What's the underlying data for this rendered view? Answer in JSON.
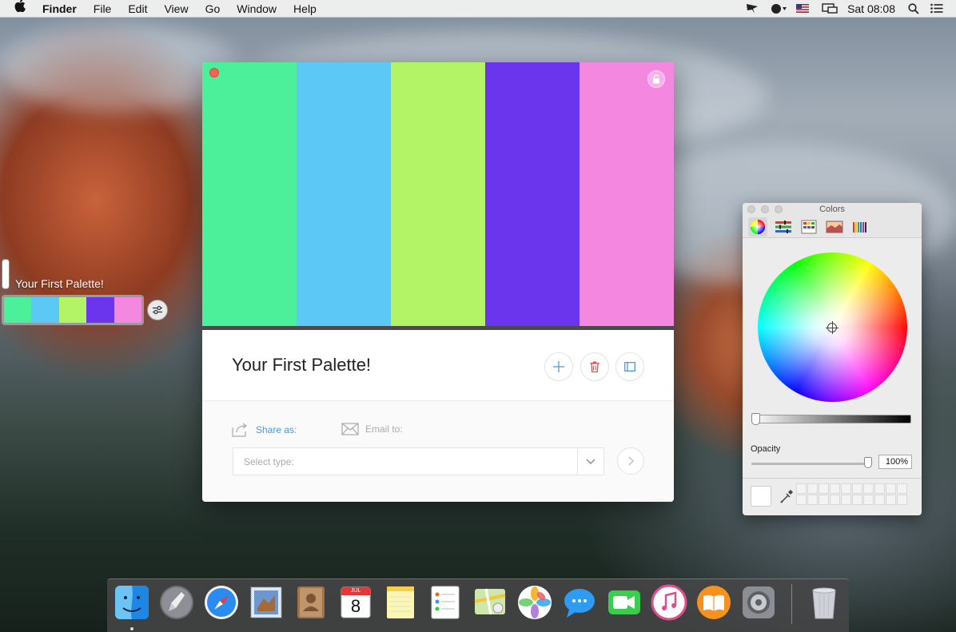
{
  "menubar": {
    "app_name": "Finder",
    "menus": [
      "File",
      "Edit",
      "View",
      "Go",
      "Window",
      "Help"
    ],
    "clock": "Sat 08:08"
  },
  "sidebar_widget": {
    "title": "Your First Palette!",
    "colors": [
      "#4cf09b",
      "#5bc8f6",
      "#b3f466",
      "#6a35ec",
      "#f487e0"
    ]
  },
  "palette_window": {
    "colors": [
      "#4cf09b",
      "#5bc8f6",
      "#b3f466",
      "#6a35ec",
      "#f487e0"
    ],
    "title": "Your First Palette!",
    "share_label": "Share as:",
    "email_label": "Email to:",
    "select_placeholder": "Select type:",
    "accent": "#4a9be0",
    "delete_color": "#e8474c"
  },
  "colors_panel": {
    "title": "Colors",
    "tabs": [
      "color-wheel",
      "color-sliders",
      "color-palettes",
      "image-palettes",
      "pencils"
    ],
    "opacity_label": "Opacity",
    "opacity_value": "100%",
    "opacity_fraction": 1.0
  },
  "dock": {
    "apps": [
      "Finder",
      "Launchpad",
      "Safari",
      "Mail",
      "Contacts",
      "Calendar",
      "Notes",
      "Reminders",
      "Maps",
      "Photos",
      "Messages",
      "FaceTime",
      "iTunes",
      "iBooks",
      "System Preferences",
      "Trash"
    ],
    "calendar_month": "JUL",
    "calendar_day": "8"
  }
}
